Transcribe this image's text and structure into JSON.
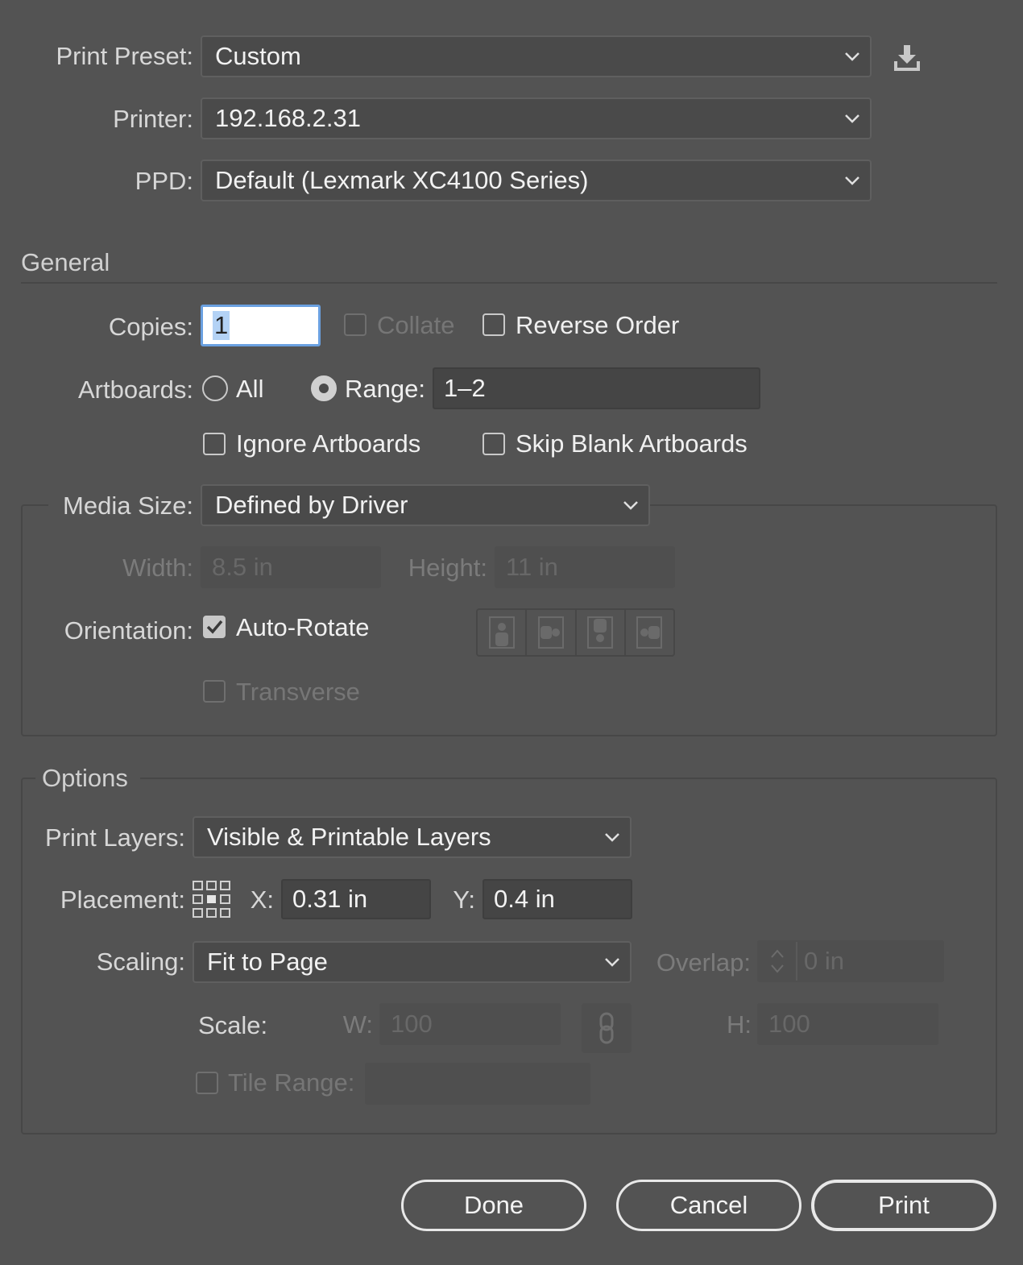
{
  "print_preset": {
    "label": "Print Preset:",
    "value": "Custom",
    "save_icon": "save-preset-icon"
  },
  "printer": {
    "label": "Printer:",
    "value": "192.168.2.31"
  },
  "ppd": {
    "label": "PPD:",
    "value": "Default (Lexmark XC4100 Series)"
  },
  "general": {
    "title": "General",
    "copies_label": "Copies:",
    "copies_value": "1",
    "collate_label": "Collate",
    "reverse_order_label": "Reverse Order",
    "artboards_label": "Artboards:",
    "all_label": "All",
    "range_label": "Range:",
    "range_value": "1–2",
    "ignore_artboards_label": "Ignore Artboards",
    "skip_blank_label": "Skip Blank Artboards"
  },
  "media": {
    "size_label": "Media Size:",
    "size_value": "Defined by Driver",
    "width_label": "Width:",
    "width_value": "8.5 in",
    "height_label": "Height:",
    "height_value": "11 in",
    "orientation_label": "Orientation:",
    "auto_rotate_label": "Auto-Rotate",
    "auto_rotate_checked": true,
    "transverse_label": "Transverse"
  },
  "options": {
    "title": "Options",
    "print_layers_label": "Print Layers:",
    "print_layers_value": "Visible & Printable Layers",
    "placement_label": "Placement:",
    "x_label": "X:",
    "x_value": "0.31 in",
    "y_label": "Y:",
    "y_value": "0.4 in",
    "scaling_label": "Scaling:",
    "scaling_value": "Fit to Page",
    "overlap_label": "Overlap:",
    "overlap_value": "0 in",
    "scale_label": "Scale:",
    "w_label": "W:",
    "w_value": "100",
    "h_label": "H:",
    "h_value": "100",
    "tile_range_label": "Tile Range:"
  },
  "buttons": {
    "done": "Done",
    "cancel": "Cancel",
    "print": "Print"
  }
}
